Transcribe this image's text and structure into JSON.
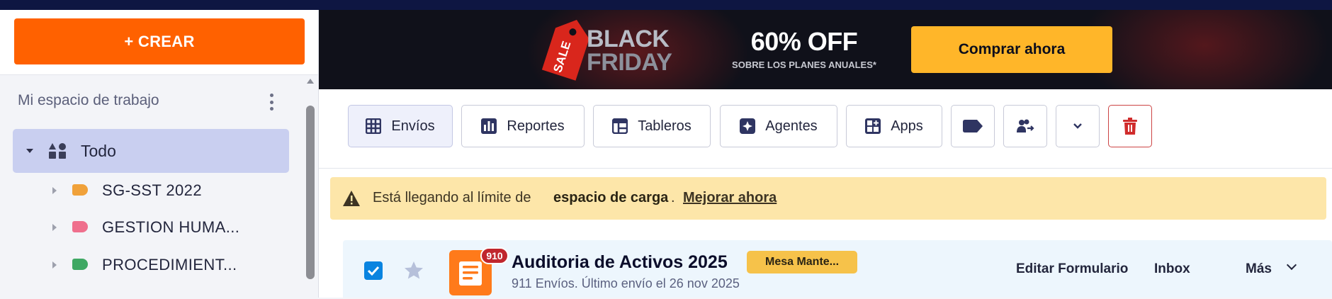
{
  "sidebar": {
    "create_label": "+ CREAR",
    "workspace_title": "Mi espacio de trabajo",
    "all_label": "Todo",
    "items": [
      {
        "label": "SG-SST 2022",
        "color": "#f0a13a"
      },
      {
        "label": "GESTION HUMA...",
        "color": "#ef6f8d"
      },
      {
        "label": "PROCEDIMIENT...",
        "color": "#3fa864"
      }
    ]
  },
  "banner": {
    "sale_tag": "SALE",
    "black": "BLACK",
    "friday": "FRIDAY",
    "offer": "60% OFF",
    "offer_sub": "SOBRE LOS PLANES ANUALES*",
    "cta": "Comprar ahora"
  },
  "toolbar": {
    "tabs": [
      {
        "label": "Envíos",
        "icon": "grid-icon"
      },
      {
        "label": "Reportes",
        "icon": "bar-chart-icon"
      },
      {
        "label": "Tableros",
        "icon": "table-icon"
      },
      {
        "label": "Agentes",
        "icon": "agent-icon"
      },
      {
        "label": "Apps",
        "icon": "apps-icon"
      }
    ],
    "icon_buttons": [
      "tag-icon",
      "assign-users-icon",
      "chevron-down-icon",
      "trash-icon"
    ]
  },
  "notice": {
    "text_pre": "Está llegando al límite de",
    "text_bold": "espacio de carga",
    "text_end": ".",
    "link": "Mejorar ahora"
  },
  "form": {
    "checked": true,
    "badge": "910",
    "title": "Auditoria de Activos 2025",
    "folder": "Mesa Mante...",
    "subtitle": "911 Envíos. Último envío el 26 nov 2025",
    "actions": {
      "edit": "Editar Formulario",
      "inbox": "Inbox",
      "more": "Más"
    }
  }
}
